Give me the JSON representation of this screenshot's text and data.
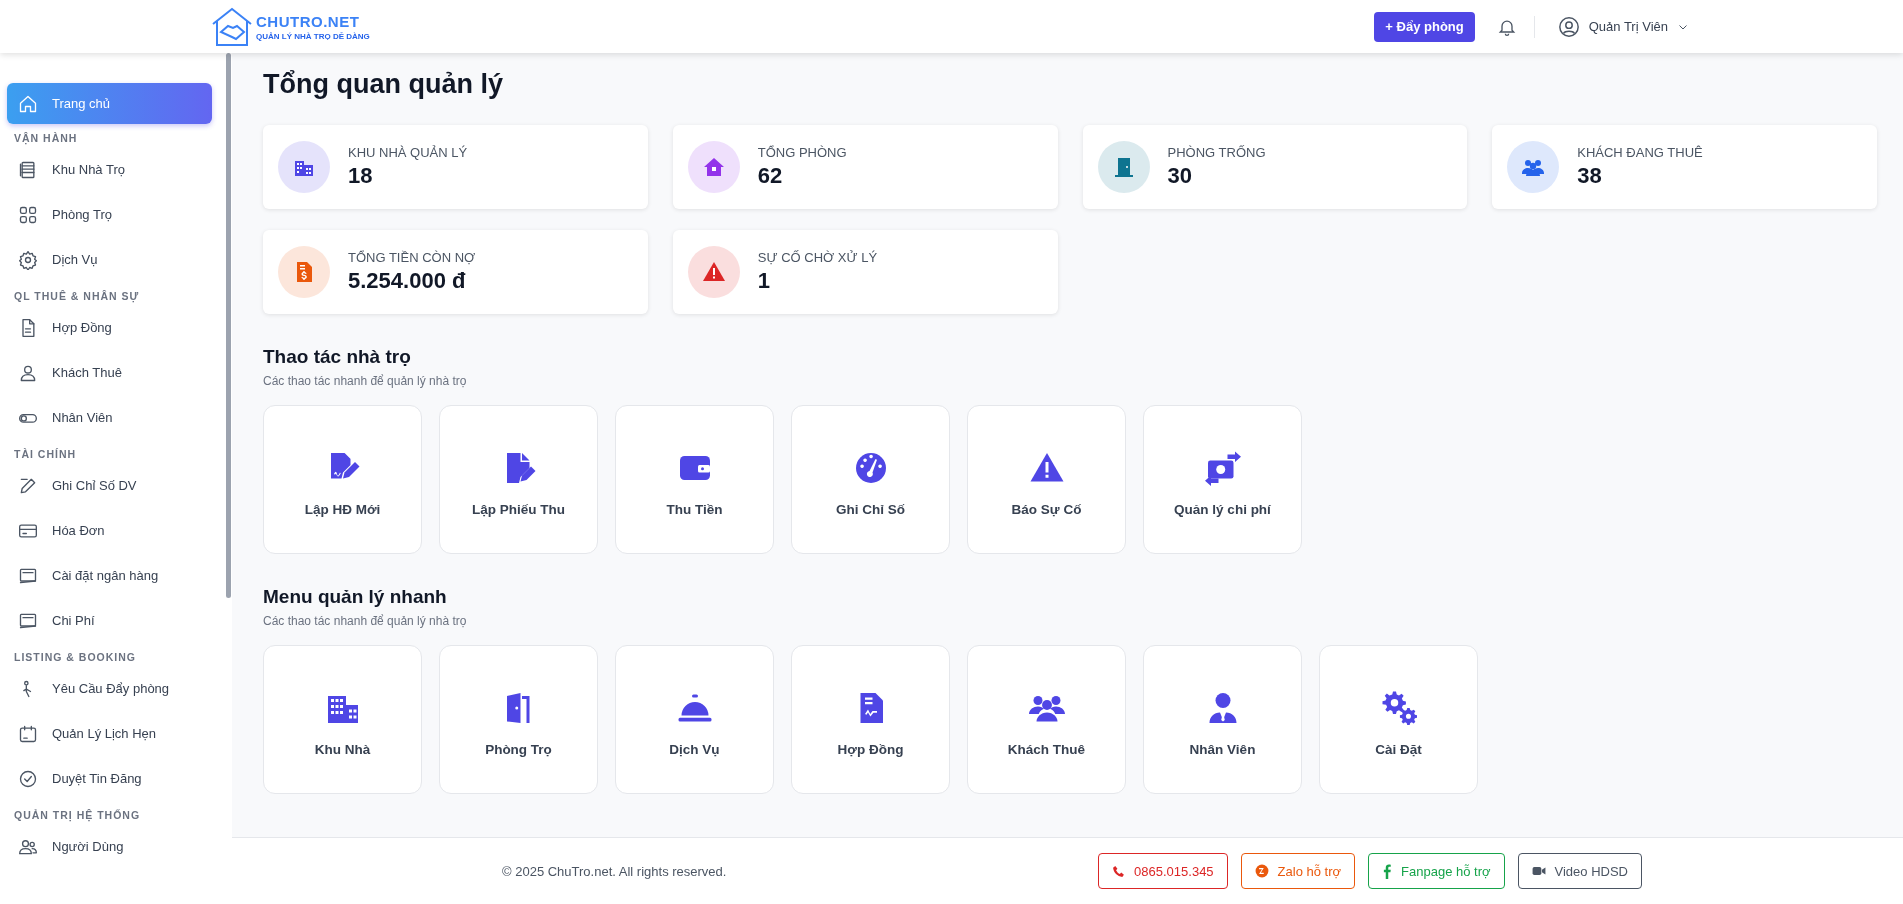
{
  "header": {
    "logo": {
      "name": "CHUTRO.NET",
      "tagline": "QUẢN LÝ NHÀ TRỌ DỄ DÀNG"
    },
    "push_button": "+ Đẩy phòng",
    "user": "Quản Trị Viên"
  },
  "sidebar": {
    "sections": [
      {
        "items": [
          {
            "label": "Trang chủ",
            "selected": true
          }
        ]
      },
      {
        "heading": "VẬN HÀNH",
        "items": [
          {
            "label": "Khu Nhà Trọ",
            "selected": false
          },
          {
            "label": "Phòng Trọ",
            "selected": false
          },
          {
            "label": "Dịch Vụ",
            "selected": false
          }
        ]
      },
      {
        "heading": "QL THUÊ & NHÂN SỰ",
        "items": [
          {
            "label": "Hợp Đồng",
            "selected": false
          },
          {
            "label": "Khách Thuê",
            "selected": false
          },
          {
            "label": "Nhân Viên",
            "selected": false
          }
        ]
      },
      {
        "heading": "TÀI CHÍNH",
        "items": [
          {
            "label": "Ghi Chỉ Số DV",
            "selected": false
          },
          {
            "label": "Hóa Đơn",
            "selected": false
          },
          {
            "label": "Cài đặt ngân hàng",
            "selected": false
          },
          {
            "label": "Chi Phí",
            "selected": false
          }
        ]
      },
      {
        "heading": "LISTING & BOOKING",
        "items": [
          {
            "label": "Yêu Cầu Đẩy phòng",
            "selected": false
          },
          {
            "label": "Quản Lý Lịch Hẹn",
            "selected": false
          },
          {
            "label": "Duyệt Tin Đăng",
            "selected": false
          }
        ]
      },
      {
        "heading": "QUẢN TRỊ HỆ THỐNG",
        "items": [
          {
            "label": "Người Dùng",
            "selected": false
          }
        ]
      }
    ]
  },
  "page_title": "Tổng quan quản lý",
  "stats": [
    {
      "label": "KHU NHÀ QUẢN LÝ",
      "value": "18",
      "color": "#4f46e5"
    },
    {
      "label": "TỔNG PHÒNG",
      "value": "62",
      "color": "#9333ea"
    },
    {
      "label": "PHÒNG TRỐNG",
      "value": "30",
      "color": "#0e7490"
    },
    {
      "label": "KHÁCH ĐANG THUÊ",
      "value": "38",
      "color": "#2563eb"
    },
    {
      "label": "TỔNG TIỀN CÒN NỢ",
      "value": "5.254.000 đ",
      "color": "#ea580c"
    },
    {
      "label": "SỰ CỐ CHỜ XỬ LÝ",
      "value": "1",
      "color": "#dc2626"
    }
  ],
  "sections": [
    {
      "title": "Thao tác nhà trọ",
      "subtitle": "Các thao tác nhanh để quản lý nhà trọ",
      "actions": [
        "Lập HĐ Mới",
        "Lập Phiếu Thu",
        "Thu Tiền",
        "Ghi Chỉ Số",
        "Báo Sự Cố",
        "Quản lý chi phí"
      ]
    },
    {
      "title": "Menu quản lý nhanh",
      "subtitle": "Các thao tác nhanh để quản lý nhà trọ",
      "actions": [
        "Khu Nhà",
        "Phòng Trọ",
        "Dịch Vụ",
        "Hợp Đồng",
        "Khách Thuê",
        "Nhân Viên",
        "Cài Đặt"
      ]
    }
  ],
  "footer": {
    "copyright": "© 2025 ChuTro.net. All rights reserved.",
    "buttons": [
      {
        "label": "0865.015.345",
        "kind": "phone",
        "color": "#dc2626"
      },
      {
        "label": "Zalo hỗ trợ",
        "kind": "zalo",
        "color": "#ea580c"
      },
      {
        "label": "Fanpage hỗ trợ",
        "kind": "facebook",
        "color": "#16a34a"
      },
      {
        "label": "Video HDSD",
        "kind": "video",
        "color": "#4b5563"
      }
    ]
  }
}
